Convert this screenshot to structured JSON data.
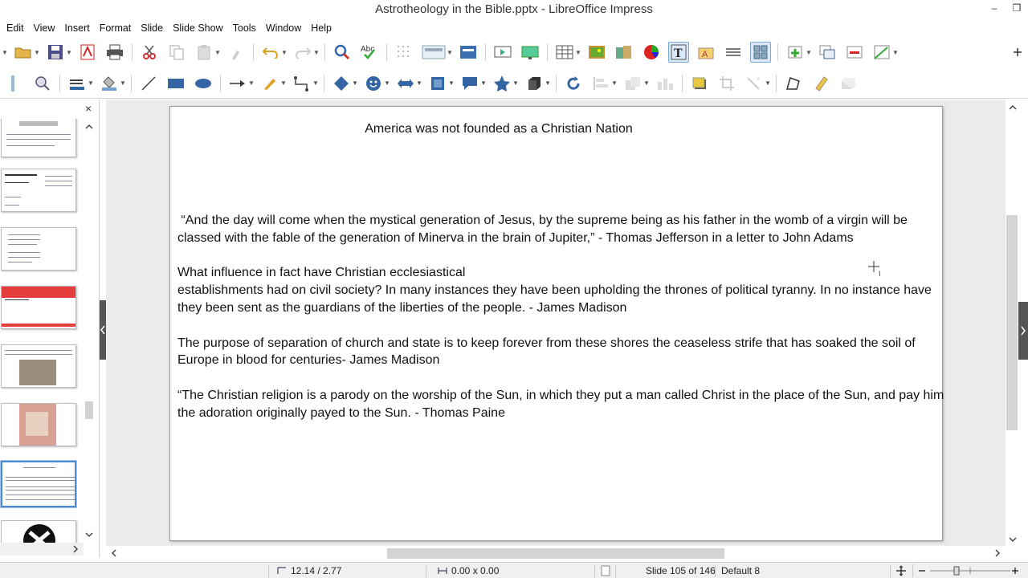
{
  "window": {
    "title": "Astrotheology in the Bible.pptx - LibreOffice Impress",
    "minimize": "‒",
    "restore": "❐"
  },
  "menu": [
    "Edit",
    "View",
    "Insert",
    "Format",
    "Slide",
    "Slide Show",
    "Tools",
    "Window",
    "Help"
  ],
  "panel": {
    "close": "×"
  },
  "slide": {
    "title": "America was not founded as a Christian Nation",
    "paragraphs": [
      " “And the day will come when the mystical generation of Jesus, by the supreme being as his father in the womb of a virgin will be classed with the fable of the generation of Minerva in the brain of Jupiter,” - Thomas Jefferson in a letter to John Adams",
      "What influence in fact have Christian ecclesiastical\nestablishments had on civil society? In many instances they have been upholding the thrones of political tyranny. In no instance have they been sent as the guardians of the liberties of the people. - James Madison",
      "The purpose of separation of church and state is to keep forever from these shores the ceaseless strife that has soaked the soil of Europe in blood for centuries- James Madison",
      "“The Christian religion is a parody on the worship of the Sun, in which they put a man called Christ in the place of the Sun, and pay him the adoration originally payed to the Sun. - Thomas Paine"
    ]
  },
  "status": {
    "position": "12.14 / 2.77",
    "size": "0.00 x 0.00",
    "slide": "Slide 105 of 146",
    "master": "Default 8"
  },
  "colors": {
    "accent": "#4a8bd1",
    "workspace": "#ebebeb"
  }
}
